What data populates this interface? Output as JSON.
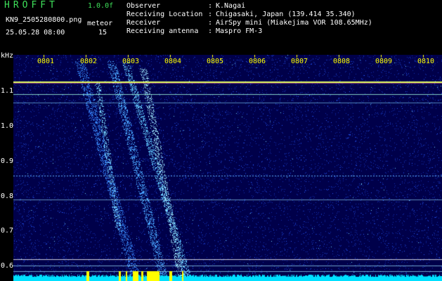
{
  "app": {
    "name": "HROFFT",
    "version": "1.0.0f"
  },
  "file": {
    "name": "KN9_2505280800.png",
    "mode": "meteor",
    "timestamp": "25.05.28 08:00",
    "count": "15"
  },
  "info": [
    {
      "label": "Observer",
      "value": "K.Nagai"
    },
    {
      "label": "Receiving Location",
      "value": "Chigasaki, Japan (139.414 35.340)"
    },
    {
      "label": "Receiver",
      "value": "AirSpy mini (Miakejima VOR 108.65MHz)"
    },
    {
      "label": "Receiving antenna",
      "value": "Maspro FM-3"
    }
  ],
  "plot": {
    "y_unit": "kHz",
    "y_ticks": [
      "1.1",
      "1.0",
      "0.9",
      "0.8",
      "0.7",
      "0.6"
    ],
    "x_ticks": [
      "0801",
      "0802",
      "0803",
      "0804",
      "0805",
      "0806",
      "0807",
      "0808",
      "0809",
      "0810"
    ],
    "colors": {
      "background": "#00004a",
      "noise": "#1a3cff",
      "carrier": "#e0ff60",
      "baseline": "#00e0ff",
      "tick": "#ffff00"
    }
  }
}
